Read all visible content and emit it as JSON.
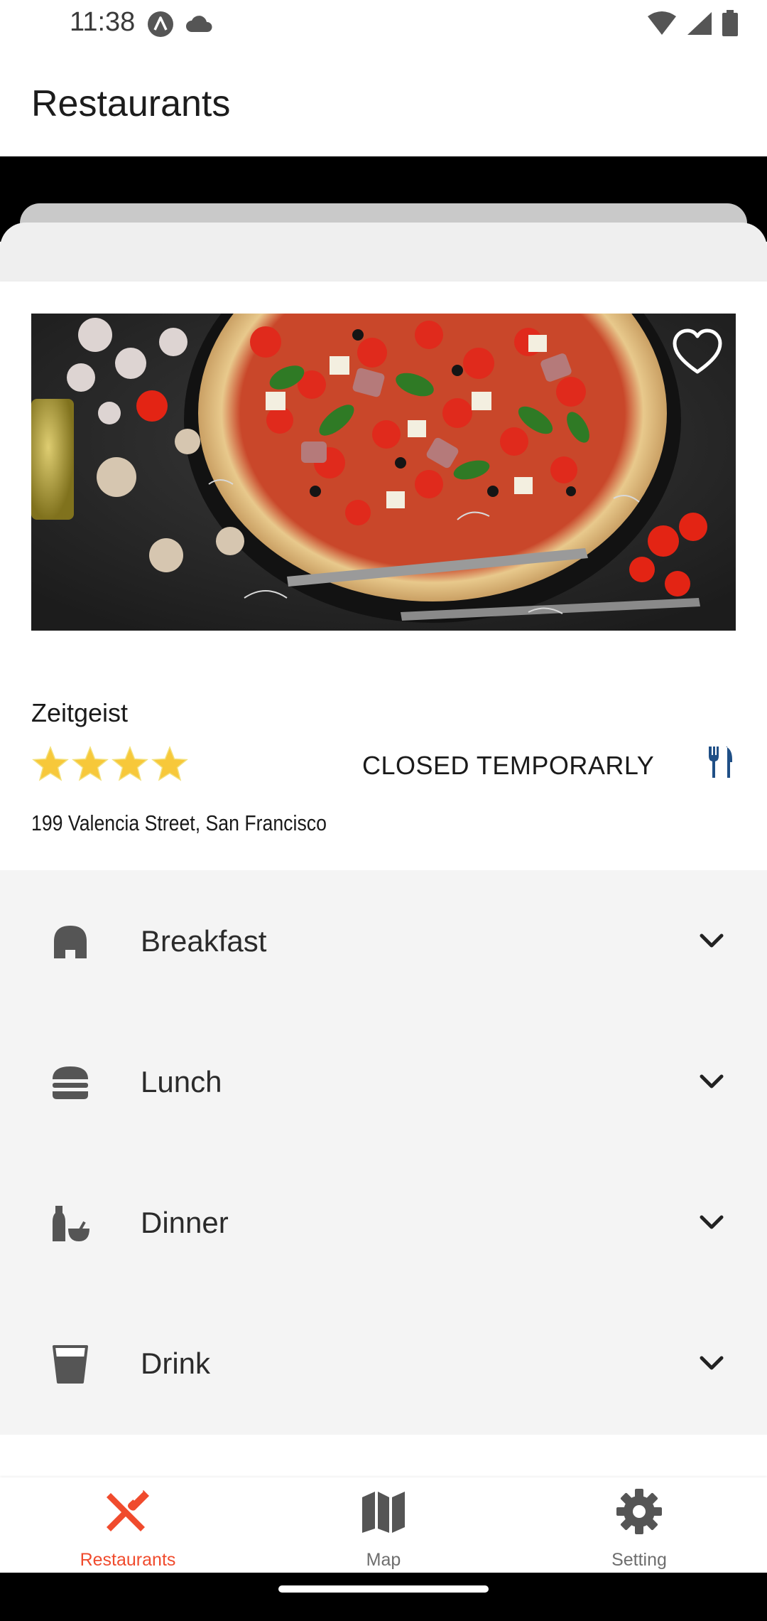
{
  "status_bar": {
    "time": "11:38",
    "left_icons": [
      "a-badge-icon",
      "cloud-icon"
    ],
    "right_icons": [
      "wifi-icon",
      "signal-icon",
      "battery-icon"
    ]
  },
  "app_bar": {
    "title": "Restaurants"
  },
  "restaurant": {
    "name": "Zeitgeist",
    "rating_stars": 4,
    "status": "CLOSED TEMPORARLY",
    "address": "199 Valencia Street, San Francisco",
    "image_icon": "pizza-photo",
    "favorite_icon": "heart-outline-icon",
    "type_icon": "cutlery-icon"
  },
  "menu": {
    "sections": [
      {
        "label": "Breakfast",
        "icon": "bread-icon"
      },
      {
        "label": "Lunch",
        "icon": "burger-icon"
      },
      {
        "label": "Dinner",
        "icon": "bottle-bowl-icon"
      },
      {
        "label": "Drink",
        "icon": "glass-icon"
      }
    ]
  },
  "bottom_nav": {
    "items": [
      {
        "label": "Restaurants",
        "icon": "cutlery-cross-icon",
        "active": true
      },
      {
        "label": "Map",
        "icon": "map-icon",
        "active": false
      },
      {
        "label": "Setting",
        "icon": "gear-icon",
        "active": false
      }
    ]
  },
  "colors": {
    "accent": "#f04b2d",
    "icon_gray": "#555555",
    "cutlery_blue": "#1f4f86",
    "star": "#f7c83a"
  }
}
